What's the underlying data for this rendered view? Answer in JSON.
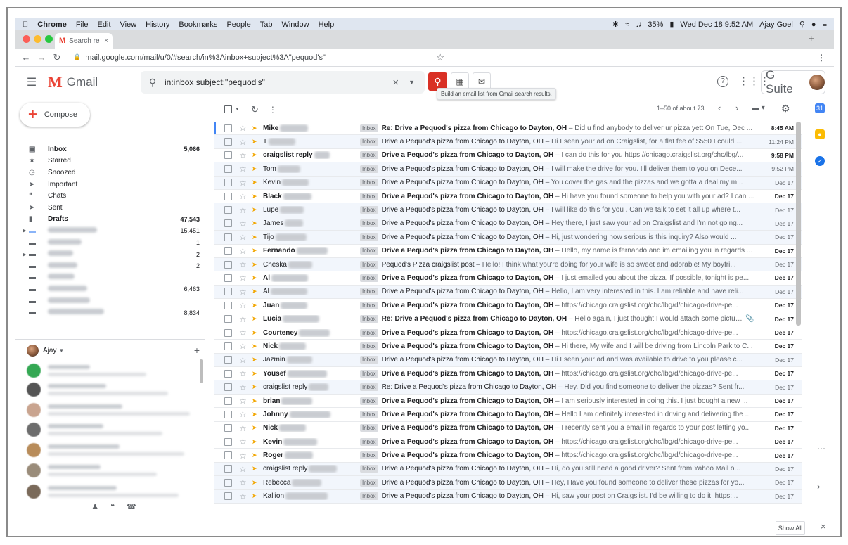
{
  "menubar": {
    "apple": "",
    "items": [
      "Chrome",
      "File",
      "Edit",
      "View",
      "History",
      "Bookmarks",
      "People",
      "Tab",
      "Window",
      "Help"
    ],
    "status": {
      "battery": "35%",
      "datetime": "Wed Dec 18 9:52 AM",
      "user": "Ajay Goel"
    }
  },
  "browser": {
    "tab_title": "Search re",
    "url": "mail.google.com/mail/u/0/#search/in%3Ainbox+subject%3A\"pequod's\""
  },
  "gmail": {
    "logo_text": "Gmail",
    "search_query": "in:inbox subject:\"pequod's\"",
    "tooltip": "Build an email list from Gmail search results.",
    "gsuite": "G Suite",
    "compose": "Compose",
    "pager": "1–50 of about 73",
    "nav": [
      {
        "label": "Inbox",
        "count": "5,066",
        "bold": true,
        "icon": "inbox-icon"
      },
      {
        "label": "Starred",
        "count": "",
        "bold": false,
        "icon": "star-icon"
      },
      {
        "label": "Snoozed",
        "count": "",
        "bold": false,
        "icon": "clock-icon"
      },
      {
        "label": "Important",
        "count": "",
        "bold": false,
        "icon": "important-icon"
      },
      {
        "label": "Chats",
        "count": "",
        "bold": false,
        "icon": "chat-icon"
      },
      {
        "label": "Sent",
        "count": "",
        "bold": false,
        "icon": "send-icon"
      },
      {
        "label": "Drafts",
        "count": "47,543",
        "bold": true,
        "icon": "draft-icon"
      },
      {
        "label": "",
        "count": "15,451",
        "bold": false,
        "icon": "label-icon"
      },
      {
        "label": "",
        "count": "1",
        "bold": false,
        "icon": "label-icon"
      },
      {
        "label": "",
        "count": "2",
        "bold": false,
        "icon": "label-icon"
      },
      {
        "label": "",
        "count": "2",
        "bold": false,
        "icon": "label-icon"
      },
      {
        "label": "",
        "count": "",
        "bold": false,
        "icon": "label-icon"
      },
      {
        "label": "",
        "count": "6,463",
        "bold": false,
        "icon": "label-icon"
      },
      {
        "label": "",
        "count": "",
        "bold": false,
        "icon": "label-icon"
      },
      {
        "label": "",
        "count": "8,834",
        "bold": false,
        "icon": "label-icon"
      }
    ],
    "hangouts_user": "Ajay",
    "show_all": "Show All",
    "emails": [
      {
        "sender": "Mike",
        "subject": "Re: Drive a Pequod's pizza from Chicago to Dayton, OH",
        "snippet": "Did u find anybody to deliver ur pizza yett On Tue, Dec ...",
        "date": "8:45 AM",
        "unread": true
      },
      {
        "sender": "T",
        "subject": "Drive a Pequod's pizza from Chicago to Dayton, OH",
        "snippet": "Hi I seen your ad on Craigslist, for a flat fee of $550 I could ...",
        "date": "11:24 PM",
        "unread": false
      },
      {
        "sender": "craigslist reply",
        "subject": "Drive a Pequod's pizza from Chicago to Dayton, OH",
        "snippet": "I can do this for you https://chicago.craigslist.org/chc/lbg/...",
        "date": "9:58 PM",
        "unread": true
      },
      {
        "sender": "Tom",
        "subject": "Drive a Pequod's pizza from Chicago to Dayton, OH",
        "snippet": "I will make the drive for you. I'll deliver them to you on Dece...",
        "date": "9:52 PM",
        "unread": false
      },
      {
        "sender": "Kevin",
        "subject": "Drive a Pequod's pizza from Chicago to Dayton, OH",
        "snippet": "You cover the gas and the pizzas and we gotta a deal my m...",
        "date": "Dec 17",
        "unread": false
      },
      {
        "sender": "Black",
        "subject": "Drive a Pequod's pizza from Chicago to Dayton, OH",
        "snippet": "Hi have you found someone to help you with your ad? I can ...",
        "date": "Dec 17",
        "unread": true
      },
      {
        "sender": "Lupe",
        "subject": "Drive a Pequod's pizza from Chicago to Dayton, OH",
        "snippet": "I will like do this for you . Can we talk to set it all up where t...",
        "date": "Dec 17",
        "unread": false
      },
      {
        "sender": "James",
        "subject": "Drive a Pequod's pizza from Chicago to Dayton, OH",
        "snippet": "Hey there, I just saw your ad on Craigslist and I'm not going...",
        "date": "Dec 17",
        "unread": false
      },
      {
        "sender": "Tijo",
        "subject": "Drive a Pequod's pizza from Chicago to Dayton, OH",
        "snippet": "Hi, just wondering how serious is this inquiry? Also would ...",
        "date": "Dec 17",
        "unread": false
      },
      {
        "sender": "Fernando",
        "subject": "Drive a Pequod's pizza from Chicago to Dayton, OH",
        "snippet": "Hello, my name is fernando and im emailing you in regards ...",
        "date": "Dec 17",
        "unread": true
      },
      {
        "sender": "Cheska",
        "subject": "Pequod's Pizza craigslist post",
        "snippet": "Hello! I think what you're doing for your wife is so sweet and adorable! My boyfri...",
        "date": "Dec 17",
        "unread": false
      },
      {
        "sender": "Al",
        "subject": "Drive a Pequod's pizza from Chicago to Dayton, OH",
        "snippet": "I just emailed you about the pizza. If possible, tonight is pe...",
        "date": "Dec 17",
        "unread": true
      },
      {
        "sender": "Al",
        "subject": "Drive a Pequod's pizza from Chicago to Dayton, OH",
        "snippet": "Hello, I am very interested in this. I am reliable and have reli...",
        "date": "Dec 17",
        "unread": false
      },
      {
        "sender": "Juan",
        "subject": "Drive a Pequod's pizza from Chicago to Dayton, OH",
        "snippet": "https://chicago.craigslist.org/chc/lbg/d/chicago-drive-pe...",
        "date": "Dec 17",
        "unread": true
      },
      {
        "sender": "Lucia",
        "subject": "Re: Drive a Pequod's pizza from Chicago to Dayton, OH",
        "snippet": "Hello again, I just thought I would attach some pictures...",
        "date": "Dec 17",
        "unread": true,
        "attachment": true
      },
      {
        "sender": "Courteney",
        "subject": "Drive a Pequod's pizza from Chicago to Dayton, OH",
        "snippet": "https://chicago.craigslist.org/chc/lbg/d/chicago-drive-pe...",
        "date": "Dec 17",
        "unread": true
      },
      {
        "sender": "Nick",
        "subject": "Drive a Pequod's pizza from Chicago to Dayton, OH",
        "snippet": "Hi there, My wife and I will be driving from Lincoln Park to C...",
        "date": "Dec 17",
        "unread": true
      },
      {
        "sender": "Jazmin",
        "subject": "Drive a Pequod's pizza from Chicago to Dayton, OH",
        "snippet": "Hi I seen your ad and was available to drive to you please c...",
        "date": "Dec 17",
        "unread": false
      },
      {
        "sender": "Yousef",
        "subject": "Drive a Pequod's pizza from Chicago to Dayton, OH",
        "snippet": "https://chicago.craigslist.org/chc/lbg/d/chicago-drive-pe...",
        "date": "Dec 17",
        "unread": true
      },
      {
        "sender": "craigslist reply",
        "subject": "Re: Drive a Pequod's pizza from Chicago to Dayton, OH",
        "snippet": "Hey. Did you find someone to deliver the pizzas? Sent fr...",
        "date": "Dec 17",
        "unread": false
      },
      {
        "sender": "brian",
        "subject": "Drive a Pequod's pizza from Chicago to Dayton, OH",
        "snippet": "I am seriously interested in doing this. I just bought a new ...",
        "date": "Dec 17",
        "unread": true
      },
      {
        "sender": "Johnny",
        "subject": "Drive a Pequod's pizza from Chicago to Dayton, OH",
        "snippet": "Hello I am definitely interested in driving and delivering the ...",
        "date": "Dec 17",
        "unread": true
      },
      {
        "sender": "Nick",
        "subject": "Drive a Pequod's pizza from Chicago to Dayton, OH",
        "snippet": "I recently sent you a email in regards to your post letting yo...",
        "date": "Dec 17",
        "unread": true
      },
      {
        "sender": "Kevin",
        "subject": "Drive a Pequod's pizza from Chicago to Dayton, OH",
        "snippet": "https://chicago.craigslist.org/chc/lbg/d/chicago-drive-pe...",
        "date": "Dec 17",
        "unread": true
      },
      {
        "sender": "Roger",
        "subject": "Drive a Pequod's pizza from Chicago to Dayton, OH",
        "snippet": "https://chicago.craigslist.org/chc/lbg/d/chicago-drive-pe...",
        "date": "Dec 17",
        "unread": true
      },
      {
        "sender": "craigslist reply",
        "subject": "Drive a Pequod's pizza from Chicago to Dayton, OH",
        "snippet": "Hi, do you still need a good driver? Sent from Yahoo Mail o...",
        "date": "Dec 17",
        "unread": false
      },
      {
        "sender": "Rebecca",
        "subject": "Drive a Pequod's pizza from Chicago to Dayton, OH",
        "snippet": "Hey, Have you found someone to deliver these pizzas for yo...",
        "date": "Dec 17",
        "unread": false
      },
      {
        "sender": "Kallion",
        "subject": "Drive a Pequod's pizza from Chicago to Dayton, OH",
        "snippet": "Hi, saw your post on Craigslist. I'd be willing to do it. https:...",
        "date": "Dec 17",
        "unread": false
      }
    ],
    "label_chip": "Inbox",
    "colors": {
      "search_red": "#d93025",
      "important_yellow": "#f2a600",
      "read_row": "#f2f6fc"
    }
  }
}
